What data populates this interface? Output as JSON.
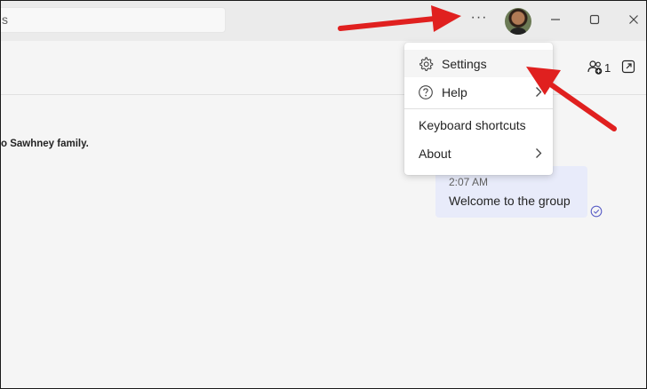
{
  "titlebar": {
    "search_text": "s",
    "more_label": "···",
    "minimize_label": "—",
    "maximize_label": "☐",
    "close_label": "✕"
  },
  "header": {
    "participants_count": "1"
  },
  "chat": {
    "notice": "o Sawhney family.",
    "message": {
      "time": "2:07 AM",
      "text": "Welcome to the group"
    }
  },
  "menu": {
    "items": [
      {
        "label": "Settings",
        "icon": "gear-icon"
      },
      {
        "label": "Help",
        "icon": "help-circle-icon",
        "has_submenu": true
      },
      {
        "label": "Keyboard shortcuts"
      },
      {
        "label": "About",
        "has_submenu": true
      }
    ]
  },
  "annotations": {
    "arrow_color": "#e0201f"
  }
}
